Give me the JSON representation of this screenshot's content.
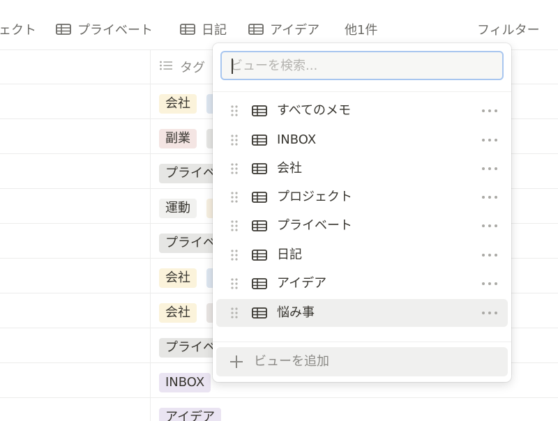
{
  "tabs": [
    {
      "label": "ェクト"
    },
    {
      "label": "プライベート"
    },
    {
      "label": "日記"
    },
    {
      "label": "アイデア"
    }
  ],
  "more_views": "他1件",
  "filter": "フィルター",
  "table": {
    "tag_column": "タグ",
    "rows": [
      {
        "tag": "会社",
        "color": "#fbf3db",
        "second_color": "#dde6f0"
      },
      {
        "tag": "副業",
        "color": "#f4e5e3",
        "second_color": "#e6e6e4"
      },
      {
        "tag": "プライベ",
        "color": "#e6e6e4",
        "second_color": ""
      },
      {
        "tag": "運動",
        "color": "#f1f1ef",
        "second_color": "#f6efe0"
      },
      {
        "tag": "プライベ",
        "color": "#e6e6e4",
        "second_color": ""
      },
      {
        "tag": "会社",
        "color": "#fbf3db",
        "second_color": "#dde6f0"
      },
      {
        "tag": "会社",
        "color": "#fbf3db",
        "second_color": "#e9e5e3"
      },
      {
        "tag": "プライベ",
        "color": "#e6e6e4",
        "second_color": ""
      },
      {
        "tag": "INBOX",
        "color": "#eae4f2",
        "second_color": ""
      },
      {
        "tag": "アイデア",
        "color": "#eae4f2",
        "second_color": ""
      }
    ]
  },
  "menu": {
    "search_placeholder": "ビューを検索...",
    "views": [
      {
        "label": "すべてのメモ",
        "icon": "table-icon"
      },
      {
        "label": "INBOX",
        "icon": "table-icon"
      },
      {
        "label": "会社",
        "icon": "table-icon"
      },
      {
        "label": "プロジェクト",
        "icon": "table-icon"
      },
      {
        "label": "プライベート",
        "icon": "table-icon"
      },
      {
        "label": "日記",
        "icon": "table-icon"
      },
      {
        "label": "アイデア",
        "icon": "table-icon"
      },
      {
        "label": "悩み事",
        "icon": "table-icon",
        "selected": true
      }
    ],
    "add_view_label": "ビューを追加"
  }
}
